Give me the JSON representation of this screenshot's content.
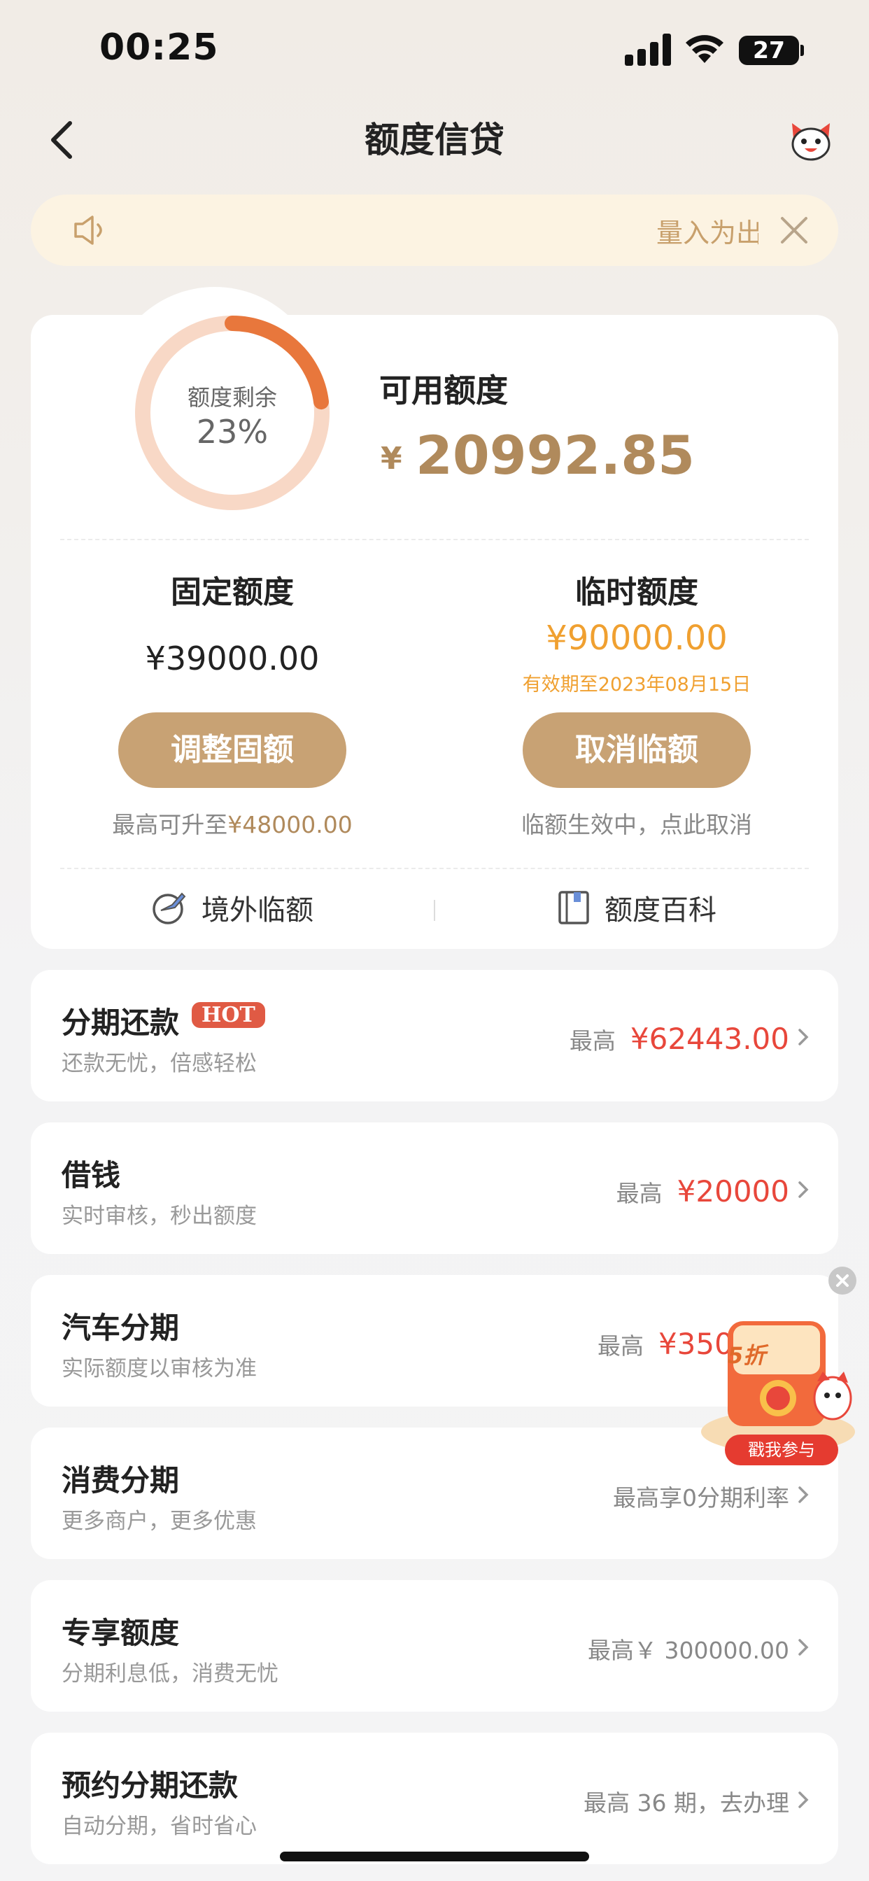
{
  "status_bar": {
    "time": "00:25",
    "battery": "27"
  },
  "nav": {
    "title": "额度信贷"
  },
  "notice": {
    "text": "量入为出"
  },
  "credit": {
    "ring_label": "额度剩余",
    "ring_percent": "23%",
    "remaining_fraction": 0.23,
    "available_label": "可用额度",
    "available_currency": "¥",
    "available_amount": "20992.85",
    "fixed": {
      "title": "固定额度",
      "amount": "¥39000.00",
      "button": "调整固额",
      "note_prefix": "最高可升至",
      "note_amount": "¥48000.00"
    },
    "temporary": {
      "title": "临时额度",
      "amount": "¥90000.00",
      "validity": "有效期至2023年08月15日",
      "button": "取消临额",
      "note": "临额生效中，点此取消"
    },
    "links": {
      "overseas": "境外临额",
      "encyclopedia": "额度百科"
    }
  },
  "rows": [
    {
      "title": "分期还款",
      "badge": "HOT",
      "subtitle": "还款无忧，倍感轻松",
      "right_prefix": "最高",
      "right_amount": "¥62443.00"
    },
    {
      "title": "借钱",
      "subtitle": "实时审核，秒出额度",
      "right_prefix": "最高",
      "right_amount": "¥20000"
    },
    {
      "title": "汽车分期",
      "subtitle": "实际额度以审核为准",
      "right_prefix": "最高",
      "right_amount": "¥350000"
    },
    {
      "title": "消费分期",
      "subtitle": "更多商户，更多优惠",
      "right_text": "最高享0分期利率"
    },
    {
      "title": "专享额度",
      "subtitle": "分期利息低，消费无忧",
      "right_text": "最高￥ 300000.00"
    },
    {
      "title": "预约分期还款",
      "subtitle": "自动分期，省时省心",
      "right_text": "最高 36 期，去办理"
    }
  ],
  "promo": {
    "badge": "5折",
    "button": "戳我参与"
  },
  "colors": {
    "gold": "#b08a5c",
    "button_gold": "#c8a274",
    "orange": "#f0a030",
    "red": "#e8473b",
    "ring_fill": "#e8773c",
    "ring_track": "#f8d8c6"
  }
}
